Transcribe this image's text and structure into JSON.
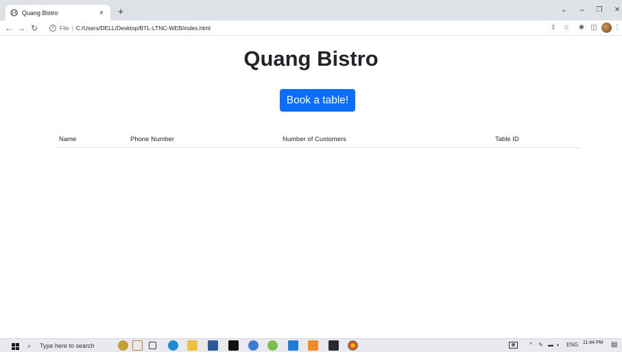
{
  "browser": {
    "tab": {
      "title": "Quang Bistro",
      "close": "×"
    },
    "new_tab": "+",
    "window_controls": {
      "minimize": "−",
      "restore": "❐",
      "close": "✕",
      "tabsearch": "⌄"
    },
    "address": {
      "scheme": "File",
      "separator": "|",
      "url": "C:/Users/DELL/Desktop/BTL-LTNC-WEB/index.html"
    }
  },
  "page": {
    "title": "Quang Bistro",
    "book_button": "Book a table!",
    "table": {
      "columns": [
        "Name",
        "Phone Number",
        "Number of Customers",
        "Table ID"
      ]
    }
  },
  "taskbar": {
    "search_placeholder": "Type here to search",
    "language": "ENG",
    "time": "11:44 PM"
  },
  "colors": {
    "primary": "#0d6efd",
    "tabstrip": "#dee1e6",
    "taskbar": "#e8eaef"
  }
}
